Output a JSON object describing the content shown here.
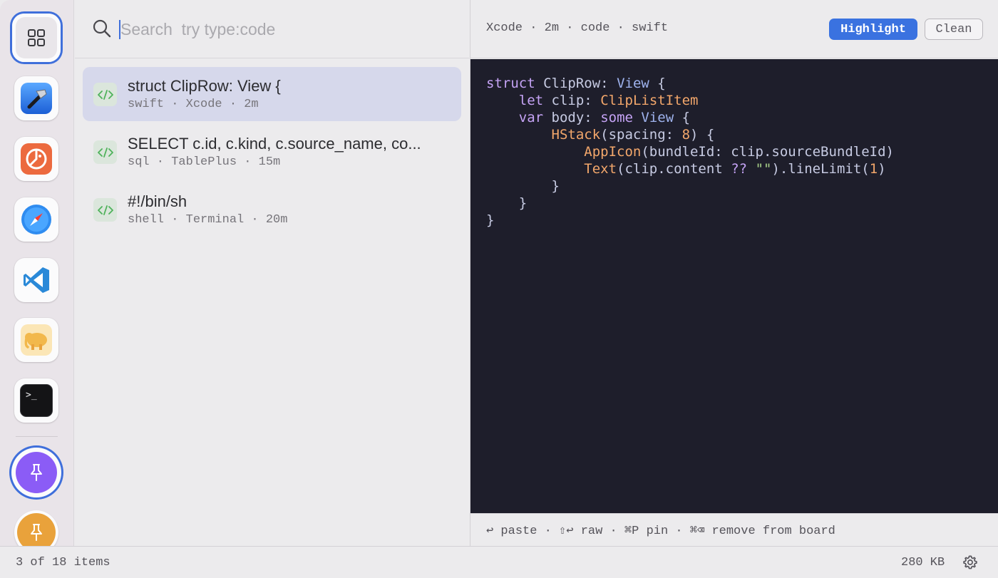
{
  "rail": {
    "items": [
      {
        "name": "all-clips",
        "icon": "grid-icon",
        "selected": true
      },
      {
        "name": "xcode",
        "icon": "xcode-hammer-icon"
      },
      {
        "name": "tableplus",
        "icon": "tableplus-elephant-icon"
      },
      {
        "name": "safari",
        "icon": "safari-compass-icon"
      },
      {
        "name": "vscode",
        "icon": "vscode-icon"
      },
      {
        "name": "sequel",
        "icon": "elephant-icon"
      },
      {
        "name": "terminal",
        "icon": "terminal-icon",
        "prompt": ">_"
      }
    ],
    "pins": [
      {
        "name": "pinboard-purple",
        "icon": "pin-icon",
        "color": "#8b5cf6",
        "selected": true
      },
      {
        "name": "pinboard-orange",
        "icon": "pin-icon",
        "color": "#e9a23b"
      }
    ]
  },
  "search": {
    "placeholder": "Search  try type:code",
    "value": ""
  },
  "list": {
    "items": [
      {
        "title": "struct ClipRow: View {",
        "meta": "swift · Xcode · 2m",
        "icon": "code-icon",
        "selected": true
      },
      {
        "title": "SELECT c.id, c.kind, c.source_name, co...",
        "meta": "sql · TablePlus · 15m",
        "icon": "code-icon"
      },
      {
        "title": "#!/bin/sh",
        "meta": "shell · Terminal · 20m",
        "icon": "code-icon"
      }
    ]
  },
  "detail": {
    "meta": "Xcode · 2m · code · swift",
    "highlight_label": "Highlight",
    "clean_label": "Clean",
    "code": [
      "struct ClipRow: View {",
      "    let clip: ClipListItem",
      "    var body: some View {",
      "        HStack(spacing: 8) {",
      "            AppIcon(bundleId: clip.sourceBundleId)",
      "            Text(clip.content ?? \"\").lineLimit(1)",
      "        }",
      "    }",
      "}"
    ],
    "hints": "↩ paste · ⇧↩ raw · ⌘P pin · ⌘⌫ remove from board"
  },
  "status": {
    "count": "3 of 18 items",
    "size": "280 KB"
  },
  "colors": {
    "accent": "#3a72e0",
    "code_bg": "#1e1e2b",
    "selected_row": "#d6d8eb"
  }
}
